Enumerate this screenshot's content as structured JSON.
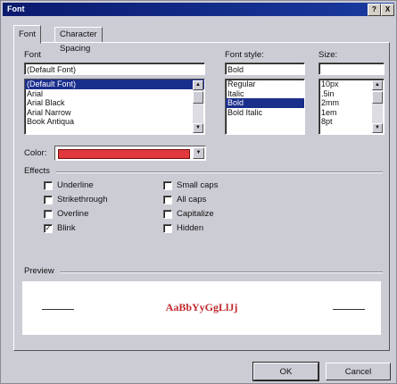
{
  "window": {
    "title": "Font",
    "help_label": "?",
    "close_label": "X"
  },
  "tabs": [
    {
      "label": "Font"
    },
    {
      "label": "Character Spacing"
    }
  ],
  "font": {
    "label": "Font",
    "value": "(Default Font)",
    "items": [
      "(Default Font)",
      "Arial",
      "Arial Black",
      "Arial Narrow",
      "Book Antiqua"
    ],
    "selected": "(Default Font)"
  },
  "font_style": {
    "label": "Font style:",
    "value": "Bold",
    "items": [
      "Regular",
      "Italic",
      "Bold",
      "Bold Italic"
    ],
    "selected": "Bold"
  },
  "size": {
    "label": "Size:",
    "value": "",
    "items": [
      "10px",
      ".5in",
      "2mm",
      "1em",
      "8pt"
    ]
  },
  "color": {
    "label": "Color:",
    "swatch": "#e0383c"
  },
  "effects": {
    "label": "Effects",
    "items": [
      {
        "label": "Underline",
        "checked": false
      },
      {
        "label": "Strikethrough",
        "checked": false
      },
      {
        "label": "Overline",
        "checked": false
      },
      {
        "label": "Blink",
        "checked": true
      },
      {
        "label": "Small caps",
        "checked": false
      },
      {
        "label": "All caps",
        "checked": false
      },
      {
        "label": "Capitalize",
        "checked": false
      },
      {
        "label": "Hidden",
        "checked": false
      }
    ]
  },
  "preview": {
    "label": "Preview",
    "sample": "AaBbYyGgLlJj",
    "sample_color": "#c0282c"
  },
  "buttons": {
    "ok": "OK",
    "cancel": "Cancel"
  },
  "colors": {
    "titlebar": "#0a1a6e",
    "selection": "#1a2e8c",
    "dialog": "#ccccd5"
  }
}
